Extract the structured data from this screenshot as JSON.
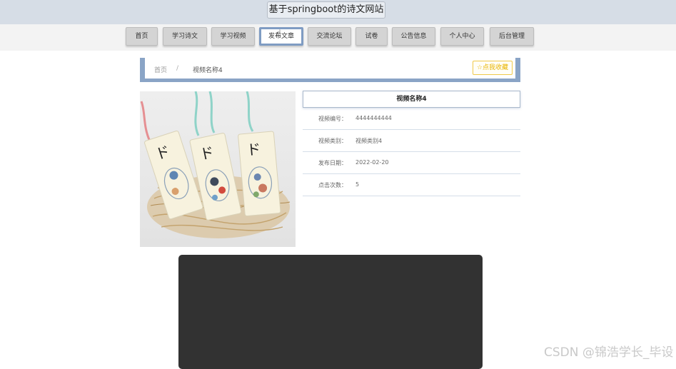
{
  "header": {
    "site_title": "基于springboot的诗文网站"
  },
  "nav": {
    "items": [
      {
        "label": "首页"
      },
      {
        "label": "学习诗文"
      },
      {
        "label": "学习视频"
      },
      {
        "label": "发布文章",
        "active": true
      },
      {
        "label": "交流论坛"
      },
      {
        "label": "试卷"
      },
      {
        "label": "公告信息"
      },
      {
        "label": "个人中心"
      },
      {
        "label": "后台管理"
      }
    ],
    "active_color": "#7f9cc3"
  },
  "breadcrumb": {
    "home": "首页",
    "separator": "/",
    "current": "视频名称4"
  },
  "favorite": {
    "icon": "star-outline-icon",
    "label": "点我收藏",
    "color": "#e8b400"
  },
  "detail": {
    "title": "视频名称4",
    "fields": [
      {
        "label": "视频编号：",
        "value": "4444444444"
      },
      {
        "label": "视频类别：",
        "value": "视频类别4"
      },
      {
        "label": "发布日期：",
        "value": "2022-02-20"
      },
      {
        "label": "点击次数：",
        "value": "5"
      }
    ]
  },
  "video": {
    "background": "#323232"
  },
  "watermark": "CSDN @锦浩学长_毕设"
}
